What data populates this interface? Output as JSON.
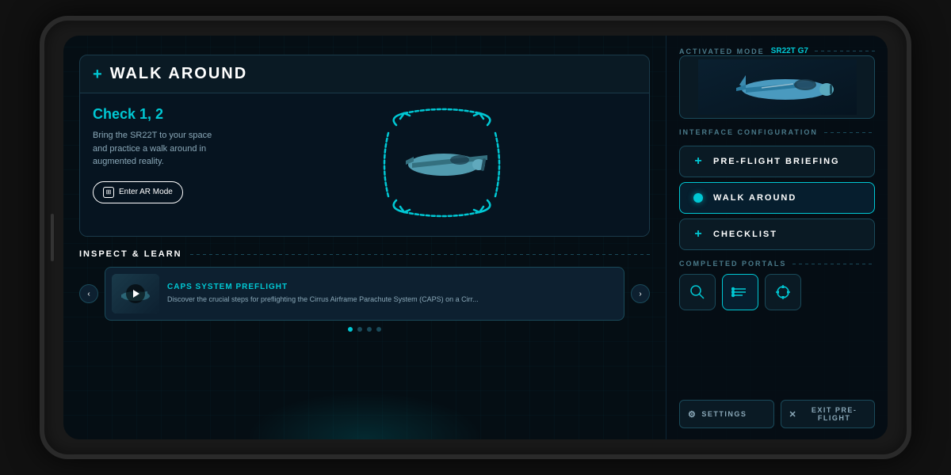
{
  "tablet": {
    "screen": {
      "left": {
        "main_card": {
          "plus_icon": "+",
          "title": "WALK AROUND",
          "check_title": "Check 1, 2",
          "check_desc": "Bring the SR22T to your space and practice a walk around in augmented reality.",
          "ar_button_label": "Enter AR Mode",
          "ar_button_icon": "⊞"
        },
        "inspect_section": {
          "title": "INSPECT & LEARN",
          "carousel": {
            "prev_arrow": "‹",
            "next_arrow": "›",
            "item": {
              "title": "CAPS SYSTEM PREFLIGHT",
              "description": "Discover the crucial steps for preflighting the Cirrus Airframe Parachute System (CAPS) on a Cirr..."
            },
            "dots": [
              true,
              false,
              false,
              false
            ]
          }
        }
      },
      "right": {
        "activated_mode": {
          "label": "ACTIVATED MODE",
          "value": "SR22T G7"
        },
        "interface_config": {
          "label": "INTERFACE CONFIGURATION"
        },
        "menu_items": [
          {
            "icon_type": "plus",
            "label": "PRE-FLIGHT BRIEFING",
            "active": false
          },
          {
            "icon_type": "dot",
            "label": "WALK AROUND",
            "active": true
          },
          {
            "icon_type": "plus",
            "label": "CHECKLIST",
            "active": false
          }
        ],
        "completed_portals": {
          "label": "COMPLETED PORTALS",
          "icons": [
            {
              "name": "search",
              "active": false
            },
            {
              "name": "list",
              "active": true
            },
            {
              "name": "move",
              "active": false
            }
          ]
        },
        "bottom_buttons": [
          {
            "icon": "⚙",
            "label": "SETTINGS"
          },
          {
            "icon": "✕",
            "label": "EXIT PRE-FLIGHT"
          }
        ]
      }
    }
  }
}
